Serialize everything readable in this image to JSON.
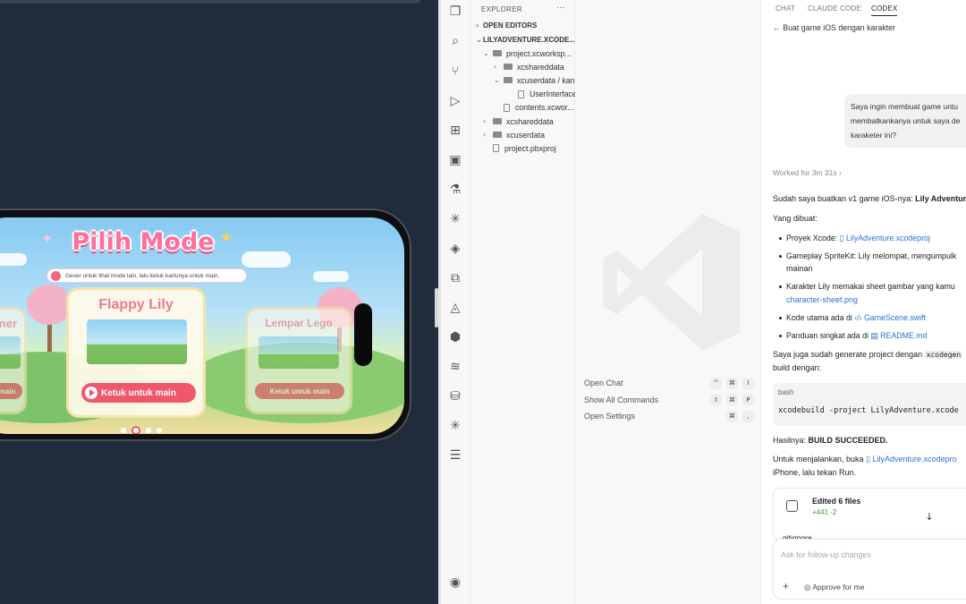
{
  "game": {
    "title": "Pilih Mode",
    "hint": "Geser untuk lihat mode lain, lalu ketuk kartunya untuk main.",
    "cards": [
      {
        "title": "nner",
        "button": "tuk untuk main"
      },
      {
        "title": "Flappy Lily",
        "button": "Ketuk untuk main"
      },
      {
        "title": "Lempar Lego",
        "button": "Ketuk untuk main"
      }
    ],
    "page_count": 4,
    "active_page": 2
  },
  "explorer": {
    "header": "EXPLORER",
    "more": "···",
    "open_editors": "OPEN EDITORS",
    "project": "LILYADVENTURE.XCODE...",
    "items": [
      {
        "label": "project.xcworksp...",
        "type": "folder",
        "chev": "⌄"
      },
      {
        "label": "xcshareddata",
        "type": "folder",
        "chev": "›"
      },
      {
        "label": "xcuserdata / kan...",
        "type": "folder",
        "chev": "⌄"
      },
      {
        "label": "UserInterface...",
        "type": "file",
        "chev": ""
      },
      {
        "label": "contents.xcwor...",
        "type": "file",
        "chev": ""
      },
      {
        "label": "xcshareddata",
        "type": "folder",
        "chev": "›"
      },
      {
        "label": "xcuserdata",
        "type": "folder",
        "chev": "›"
      },
      {
        "label": "project.pbxproj",
        "type": "file",
        "chev": ""
      }
    ]
  },
  "editor": {
    "commands": [
      {
        "label": "Open Chat",
        "keys": [
          "^",
          "⌘",
          "I"
        ]
      },
      {
        "label": "Show All Commands",
        "keys": [
          "⇧",
          "⌘",
          "P"
        ]
      },
      {
        "label": "Open Settings",
        "keys": [
          "⌘",
          ","
        ]
      }
    ]
  },
  "chat": {
    "tabs": [
      "CHAT",
      "CLAUDE CODE",
      "CODEX"
    ],
    "active_tab": "CODEX",
    "back_title": "Buat game iOS dengan karakter",
    "user_message": [
      "Saya ingin membuat game untu",
      "membatkankanya untuk saya de",
      "karaketer ini?"
    ],
    "worked": "Worked for 3m 31s",
    "reply_intro": "Sudah saya buatkan v1 game iOS-nya:",
    "reply_intro_bold": "Lily Adventur",
    "yang_dibuat": "Yang dibuat:",
    "bullets": {
      "b1_text": "Proyek Xcode:",
      "b1_link": "LilyAdventure.xcodeproj",
      "b2_line1": "Gameplay SpriteKit: Lily melompat, mengumpulk",
      "b2_line2": "mainan",
      "b3_line1": "Karakter Lily memakai sheet gambar yang kamu",
      "b3_link": "character-sheet.png",
      "b4_text": "Kode utama ada di",
      "b4_link": "GameScene.swift",
      "b5_text": "Panduan singkat ada di",
      "b5_link": "README.md"
    },
    "generate_line1": "Saya juga sudah generate project dengan",
    "generate_code": "xcodegen",
    "generate_line2": "build dengan:",
    "code_lang": "bash",
    "code": "xcodebuild -project LilyAdventure.xcode",
    "result_label": "Hasilnya:",
    "result_bold": "BUILD SUCCEEDED.",
    "run_line1": "Untuk menjalankan, buka",
    "run_link": "LilyAdventure.xcodepro",
    "run_line2": "iPhone, lalu tekan Run.",
    "edited_title": "Edited 6 files",
    "edited_add": "+441",
    "edited_del": "-2",
    "edited_file": "gitignore",
    "composer_placeholder": "Ask for follow-up changes",
    "approve_label": "Approve for me"
  }
}
